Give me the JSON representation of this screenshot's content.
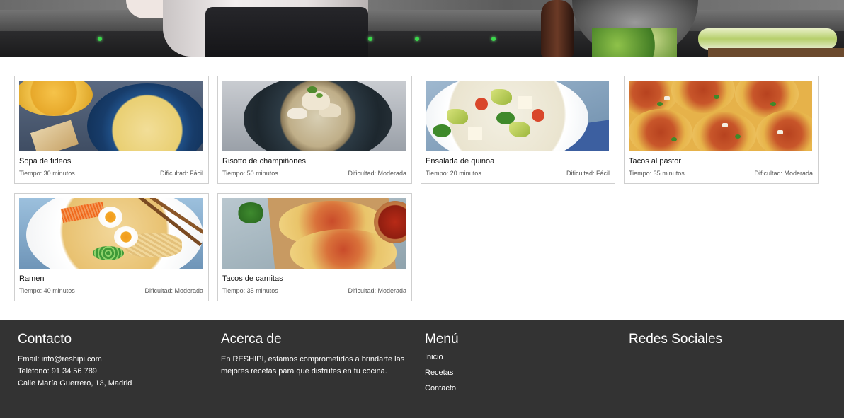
{
  "recipes": [
    {
      "title": "Sopa de fideos",
      "time": "Tiempo: 30 minutos",
      "difficulty": "Dificultad: Fácil",
      "image": "sopa-de-fideos-photo"
    },
    {
      "title": "Risotto de champiñones",
      "time": "Tiempo: 50 minutos",
      "difficulty": "Dificultad: Moderada",
      "image": "risotto-photo"
    },
    {
      "title": "Ensalada de quinoa",
      "time": "Tiempo: 20 minutos",
      "difficulty": "Dificultad: Fácil",
      "image": "ensalada-quinoa-photo"
    },
    {
      "title": "Tacos al pastor",
      "time": "Tiempo: 35 minutos",
      "difficulty": "Dificultad: Moderada",
      "image": "tacos-pastor-photo"
    },
    {
      "title": "Ramen",
      "time": "Tiempo: 40 minutos",
      "difficulty": "Dificultad: Moderada",
      "image": "ramen-photo"
    },
    {
      "title": "Tacos de carnitas",
      "time": "Tiempo: 35 minutos",
      "difficulty": "Dificultad: Moderada",
      "image": "tacos-carnitas-photo"
    }
  ],
  "footer": {
    "contact": {
      "heading": "Contacto",
      "email": "Email: info@reshipi.com",
      "phone": "Teléfono: 91 34 56 789",
      "address": "Calle María Guerrero, 13, Madrid"
    },
    "about": {
      "heading": "Acerca de",
      "text": "En RESHIPI, estamos comprometidos a brindarte las mejores recetas para que disfrutes en tu cocina."
    },
    "menu": {
      "heading": "Menú",
      "items": [
        "Inicio",
        "Recetas",
        "Contacto"
      ]
    },
    "social": {
      "heading": "Redes Sociales"
    }
  },
  "colors": {
    "footer_bg": "#333333",
    "card_border": "#cfcfcf",
    "page_bg": "#ffffff"
  }
}
